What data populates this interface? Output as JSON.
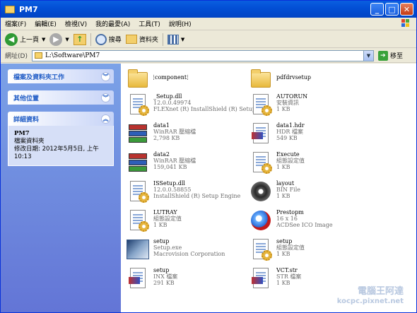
{
  "window": {
    "title": "PM7"
  },
  "menu": [
    "檔案(F)",
    "編輯(E)",
    "檢視(V)",
    "我的最愛(A)",
    "工具(T)",
    "說明(H)"
  ],
  "toolbar": {
    "back_label": "上一頁",
    "search_label": "搜尋",
    "folders_label": "資料夾"
  },
  "address": {
    "label": "網址(D)",
    "path": "L:\\Software\\PM7",
    "go_label": "移至"
  },
  "taskpane": {
    "file_tasks": "檔案及資料夾工作",
    "other_places": "其他位置",
    "details": "詳細資料",
    "detail_name": "PM7",
    "detail_type": "檔案資料夾",
    "detail_modified": "修改日期: 2012年5月5日, 上午 10:13"
  },
  "files": [
    {
      "name": "component",
      "line2": "",
      "line3": "",
      "icon": "folder-icon"
    },
    {
      "name": "pdfdrvsetup",
      "line2": "",
      "line3": "",
      "icon": "folder-icon"
    },
    {
      "name": "_Setup.dll",
      "line2": "12.0.0.49974",
      "line3": "FLEXnet (R) InstallShield (R) Setup...",
      "icon": "dll-icon"
    },
    {
      "name": "AUTORUN",
      "line2": "安裝資訊",
      "line3": "1 KB",
      "icon": "settings-file-icon"
    },
    {
      "name": "data1",
      "line2": "WinRAR 壓縮檔",
      "line3": "2,798 KB",
      "icon": "winrar-icon"
    },
    {
      "name": "data1.hdr",
      "line2": "HDR 檔案",
      "line3": "549 KB",
      "icon": "hdr-file-icon"
    },
    {
      "name": "data2",
      "line2": "WinRAR 壓縮檔",
      "line3": "159,041 KB",
      "icon": "winrar-icon"
    },
    {
      "name": "Execute",
      "line2": "組態設定值",
      "line3": "1 KB",
      "icon": "settings-file-icon"
    },
    {
      "name": "ISSetup.dll",
      "line2": "12.0.0.58855",
      "line3": "InstallShield (R) Setup Engine",
      "icon": "dll-icon"
    },
    {
      "name": "layout",
      "line2": "BIN File",
      "line3": "1 KB",
      "icon": "disc-icon"
    },
    {
      "name": "LUTRAY",
      "line2": "組態設定值",
      "line3": "1 KB",
      "icon": "settings-file-icon"
    },
    {
      "name": "Prestopm",
      "line2": "16 x 16",
      "line3": "ACDSee ICO Image",
      "icon": "ico-image-icon"
    },
    {
      "name": "setup",
      "line2": "Setup.exe",
      "line3": "Macrovision Corporation",
      "icon": "setup-exe-icon"
    },
    {
      "name": "setup",
      "line2": "組態設定值",
      "line3": "1 KB",
      "icon": "settings-file-icon"
    },
    {
      "name": "setup",
      "line2": "INX 檔案",
      "line3": "291 KB",
      "icon": "inx-file-icon"
    },
    {
      "name": "VCT.str",
      "line2": "STR 檔案",
      "line3": "1 KB",
      "icon": "str-file-icon"
    }
  ],
  "watermark": {
    "line1": "電腦王阿達",
    "line2": "kocpc.pixnet.net"
  }
}
